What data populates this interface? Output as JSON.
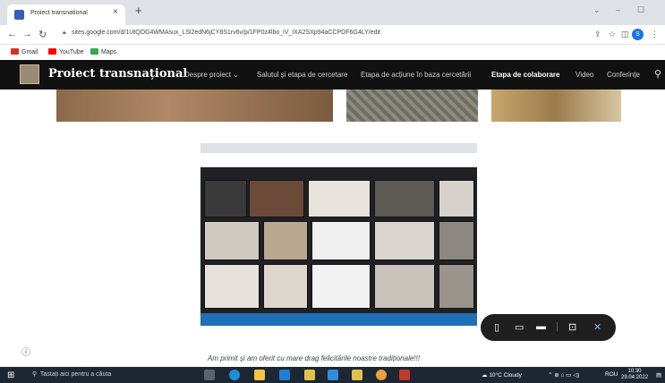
{
  "browser": {
    "tab_title": "Proiect transnational",
    "tab_close": "×",
    "new_tab": "+",
    "url": "sites.google.com/d/1UtQOG4WMAsux_LSl2edN6jCY8S1rv6v/p/1FP0z4lbo_iV_IXA2SXp94aCCPDF6G4LY/edit",
    "profile_initial": "S",
    "window_controls": [
      "⌄",
      "–",
      "☐"
    ],
    "bookmarks": [
      {
        "label": "Gmail",
        "color": "#d93025"
      },
      {
        "label": "YouTube",
        "color": "#ff0000"
      },
      {
        "label": "Maps",
        "color": "#34a853"
      }
    ]
  },
  "site": {
    "title": "Proiect transnațional",
    "nav": [
      {
        "label": "Despre proiect ⌄",
        "active": false
      },
      {
        "label": "Salutul și etapa de cercetare",
        "active": false
      },
      {
        "label": "Etapa de acțiune în baza cercetării",
        "active": false
      },
      {
        "label": "Etapa de colaborare",
        "active": true
      },
      {
        "label": "Video",
        "active": false
      },
      {
        "label": "Conferințe",
        "active": false
      }
    ]
  },
  "content": {
    "caption": "Am primit și am oferit cu mare drag felicitările noastre tradiționale!!!"
  },
  "floating_toolbar": {
    "icons": [
      "phone-icon",
      "tablet-icon",
      "desktop-icon",
      "comment-icon",
      "close-icon"
    ]
  },
  "taskbar": {
    "search_placeholder": "Tastați aici pentru a căuta",
    "weather": "10°C Cloudy",
    "language": "ROU",
    "time": "10:30",
    "date": "29.04.2022"
  }
}
